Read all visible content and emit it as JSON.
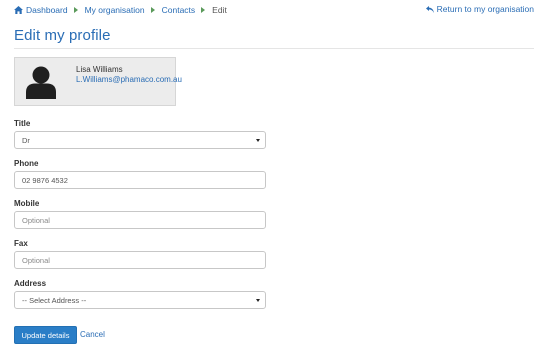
{
  "breadcrumb": {
    "items": [
      {
        "label": "Dashboard"
      },
      {
        "label": "My organisation"
      },
      {
        "label": "Contacts"
      }
    ],
    "current": "Edit"
  },
  "return_link": "Return to my organisation",
  "page": {
    "title": "Edit my profile"
  },
  "profile": {
    "name": "Lisa Williams",
    "email": "L.Williams@phamaco.com.au"
  },
  "form": {
    "title": {
      "label": "Title",
      "value": "Dr"
    },
    "phone": {
      "label": "Phone",
      "value": "02 9876 4532"
    },
    "mobile": {
      "label": "Mobile",
      "placeholder": "Optional"
    },
    "fax": {
      "label": "Fax",
      "placeholder": "Optional"
    },
    "address": {
      "label": "Address",
      "value": "-- Select Address --"
    }
  },
  "actions": {
    "submit": "Update details",
    "cancel": "Cancel"
  },
  "colors": {
    "accent": "#2a6db5",
    "primary_button": "#2a7ec7",
    "breadcrumb_separator": "#5a9a5a"
  },
  "icons": {
    "home": "home-icon",
    "return": "reply-arrow-icon",
    "avatar": "user-silhouette-icon",
    "select": "caret-down-icon"
  }
}
